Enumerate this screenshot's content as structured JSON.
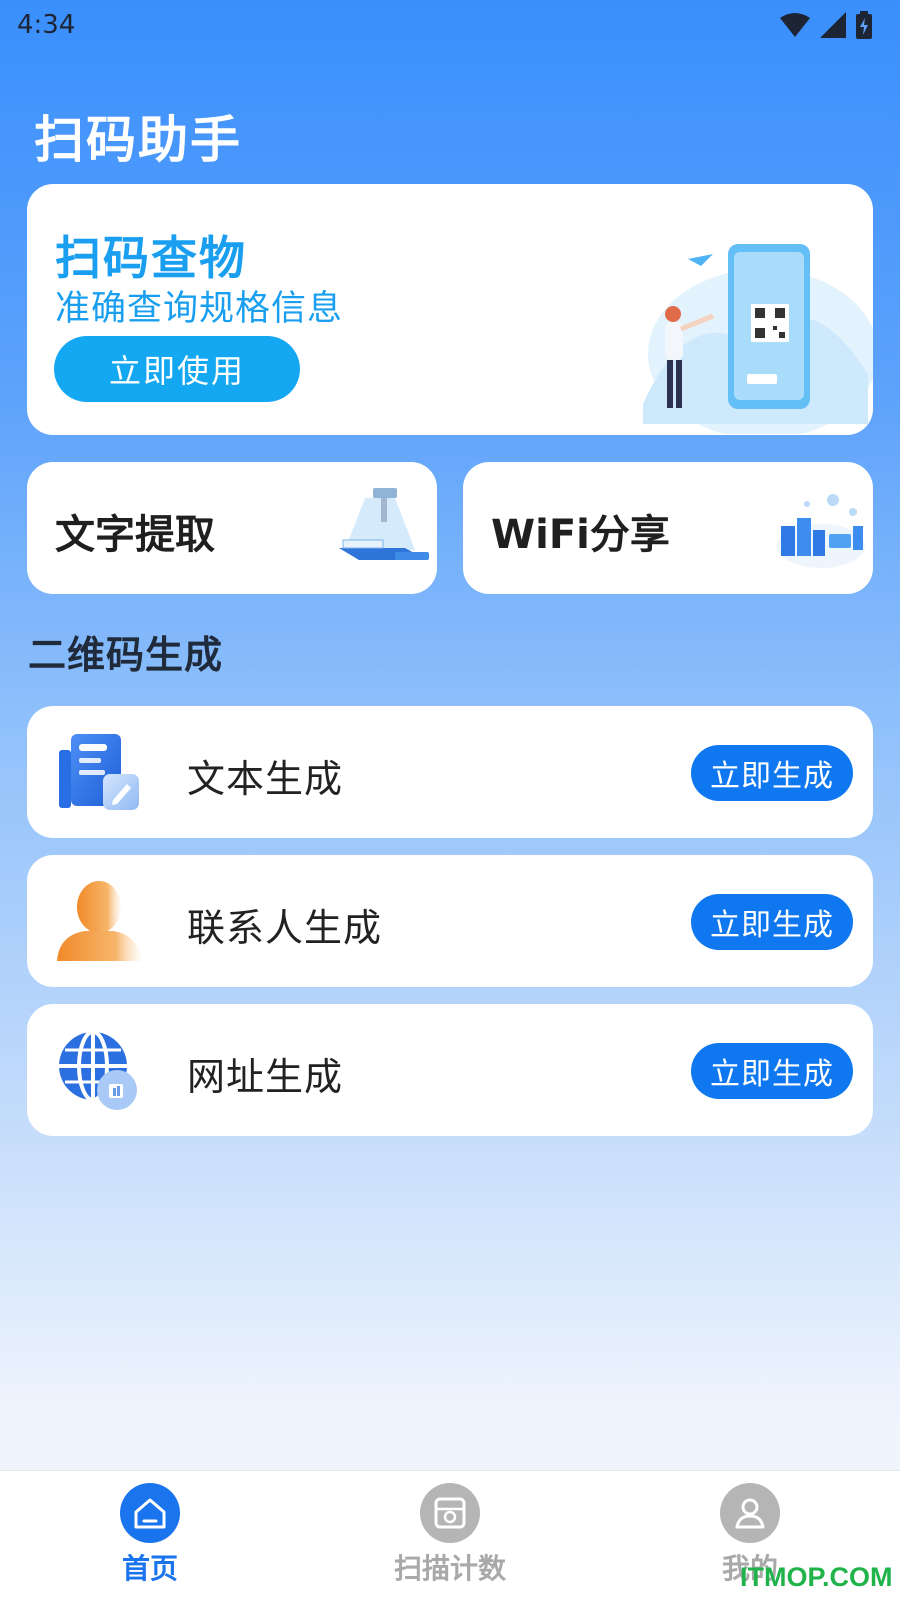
{
  "status_bar": {
    "time": "4:34"
  },
  "app": {
    "title": "扫码助手"
  },
  "hero": {
    "title": "扫码查物",
    "subtitle": "准确查询规格信息",
    "button_label": "立即使用"
  },
  "features": [
    {
      "label": "文字提取",
      "icon": "text-extract-illustration"
    },
    {
      "label": "WiFi分享",
      "icon": "wifi-share-illustration"
    }
  ],
  "qr_section": {
    "title": "二维码生成",
    "items": [
      {
        "label": "文本生成",
        "button_label": "立即生成",
        "icon": "document-edit-icon"
      },
      {
        "label": "联系人生成",
        "button_label": "立即生成",
        "icon": "contact-person-icon"
      },
      {
        "label": "网址生成",
        "button_label": "立即生成",
        "icon": "globe-icon"
      }
    ]
  },
  "tab_bar": {
    "tabs": [
      {
        "label": "首页",
        "icon": "home-icon",
        "active": true
      },
      {
        "label": "扫描计数",
        "icon": "scan-count-icon",
        "active": false
      },
      {
        "label": "我的",
        "icon": "user-icon",
        "active": false
      }
    ],
    "active_color": "#1a74ee",
    "inactive_color": "#a9a9a9"
  },
  "watermark": "ITMOP.COM",
  "colors": {
    "hero_accent": "#1a9ff0",
    "hero_button": "#14a7f2",
    "generate_button": "#0f78f0"
  }
}
